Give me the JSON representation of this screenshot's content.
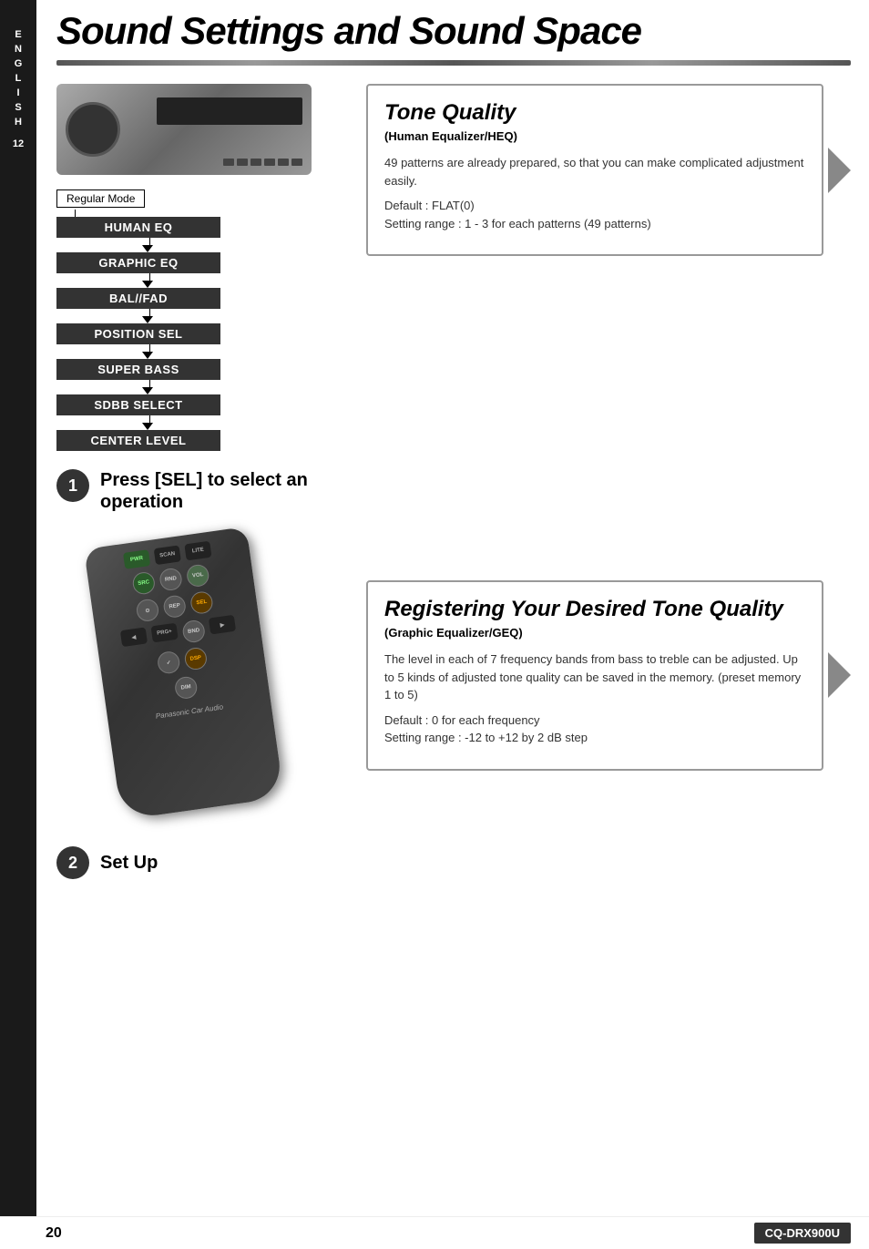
{
  "sidebar": {
    "letters": [
      "E",
      "N",
      "G",
      "L",
      "I",
      "S",
      "H"
    ],
    "page_section": "12"
  },
  "header": {
    "title": "Sound Settings and Sound Space"
  },
  "left_column": {
    "regular_mode_label": "Regular Mode",
    "menu_items": [
      "HUMAN EQ",
      "GRAPHIC EQ",
      "BAL//FAD",
      "POSITION SEL",
      "SUPER BASS",
      "SDBB SELECT",
      "CENTER LEVEL"
    ]
  },
  "step1": {
    "number": "1",
    "text": "Press [SEL] to select an operation"
  },
  "step2": {
    "number": "2",
    "text": "Set Up"
  },
  "right_column": {
    "box1": {
      "title": "Tone Quality",
      "subtitle": "(Human Equalizer/HEQ)",
      "paragraph1": "49 patterns are already prepared, so that you can make complicated adjustment easily.",
      "paragraph2": "Default : FLAT(0)\nSetting range : 1 - 3 for each patterns (49 patterns)"
    },
    "box2": {
      "title": "Registering Your Desired Tone Quality",
      "subtitle": "(Graphic Equalizer/GEQ)",
      "paragraph1": "The level in each of 7 frequency bands from bass to treble can be adjusted. Up to 5 kinds of adjusted tone quality can be saved in the memory. (preset memory 1 to 5)",
      "paragraph2": "Default : 0 for each frequency\nSetting range : -12 to +12 by 2 dB step"
    }
  },
  "footer": {
    "page_number": "20",
    "model": "CQ-DRX900U"
  },
  "remote_buttons": [
    {
      "label": "PWR",
      "type": "round"
    },
    {
      "label": "SCAN",
      "type": "rect"
    },
    {
      "label": "LITE",
      "type": "rect"
    },
    {
      "label": "SOURCE",
      "type": "round"
    },
    {
      "label": "RAND",
      "type": "round"
    },
    {
      "label": "VOL",
      "type": "round"
    },
    {
      "label": "REP",
      "type": "round"
    },
    {
      "label": "SEL",
      "type": "round"
    },
    {
      "label": "PROG+",
      "type": "rect"
    },
    {
      "label": "BAND",
      "type": "round"
    },
    {
      "label": "DISP",
      "type": "round"
    },
    {
      "label": "DIMMER",
      "type": "round"
    }
  ]
}
